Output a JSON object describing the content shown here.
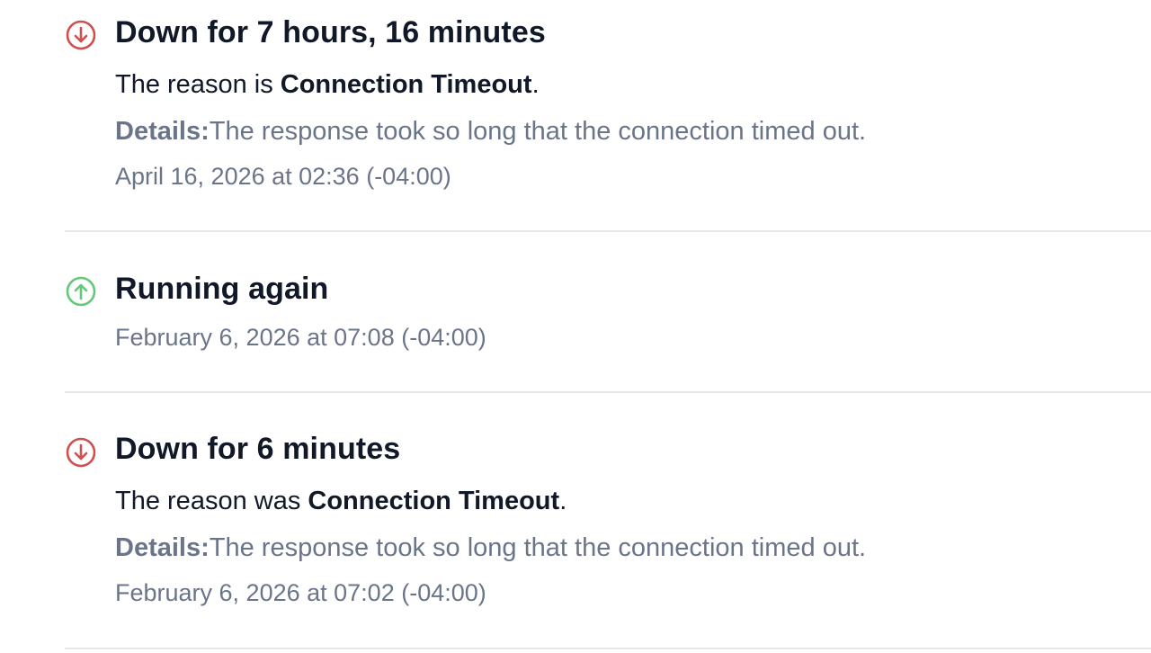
{
  "colors": {
    "down": "#d0504f",
    "up": "#62c87a",
    "divider": "#e5e7eb",
    "muted": "#6b7589"
  },
  "events": [
    {
      "status": "down",
      "icon": "arrow-down-circle-icon",
      "title": "Down for 7 hours, 16 minutes",
      "reason_prefix": "The reason is ",
      "reason": "Connection Timeout",
      "reason_suffix": ".",
      "details_label": "Details:",
      "details": "The response took so long that the connection timed out.",
      "timestamp": "April 16, 2026 at 02:36 (-04:00)"
    },
    {
      "status": "up",
      "icon": "arrow-up-circle-icon",
      "title": "Running again",
      "timestamp": "February 6, 2026 at 07:08 (-04:00)"
    },
    {
      "status": "down",
      "icon": "arrow-down-circle-icon",
      "title": "Down for 6 minutes",
      "reason_prefix": "The reason was ",
      "reason": "Connection Timeout",
      "reason_suffix": ".",
      "details_label": "Details:",
      "details": "The response took so long that the connection timed out.",
      "timestamp": "February 6, 2026 at 07:02 (-04:00)"
    }
  ]
}
